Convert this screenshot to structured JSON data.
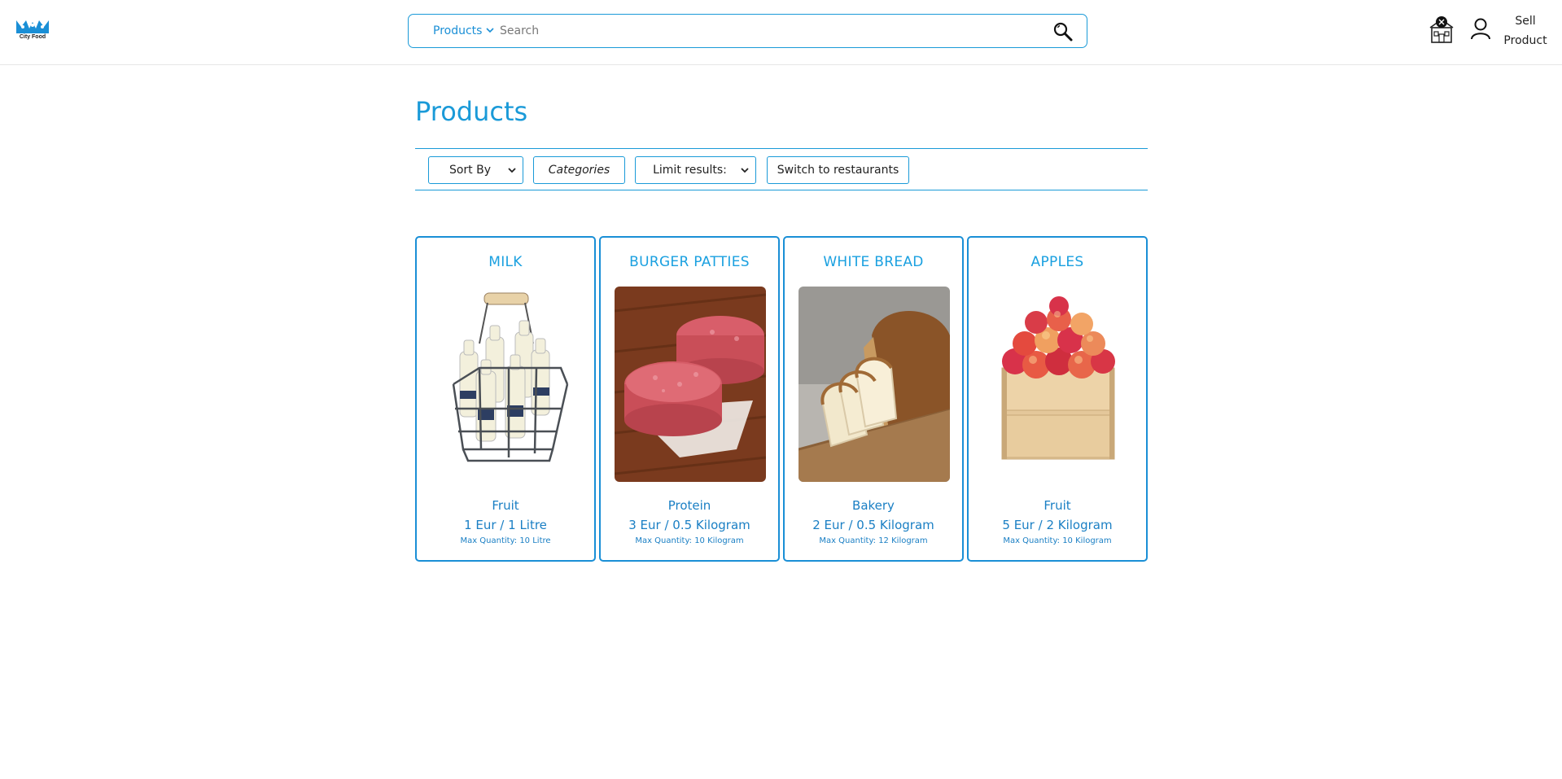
{
  "header": {
    "logo_text": "City Food",
    "search": {
      "selected_type": "Products",
      "placeholder": "Search"
    },
    "sell_label_line1": "Sell",
    "sell_label_line2": "Product",
    "icons": [
      "restaurant-icon",
      "user-icon",
      "search-icon",
      "chevron-down-icon"
    ]
  },
  "main": {
    "title": "Products",
    "toolbar": {
      "sort_label": "Sort By",
      "categories_label": "Categories",
      "limit_label": "Limit results:",
      "switch_label": "Switch to restaurants"
    },
    "products": [
      {
        "name": "MILK",
        "category": "Fruit",
        "price": "1 Eur / 1 Litre",
        "max": "Max Quantity: 10 Litre"
      },
      {
        "name": "BURGER PATTIES",
        "category": "Protein",
        "price": "3 Eur / 0.5 Kilogram",
        "max": "Max Quantity: 10 Kilogram"
      },
      {
        "name": "WHITE BREAD",
        "category": "Bakery",
        "price": "2 Eur / 0.5 Kilogram",
        "max": "Max Quantity: 12 Kilogram"
      },
      {
        "name": "APPLES",
        "category": "Fruit",
        "price": "5 Eur / 2 Kilogram",
        "max": "Max Quantity: 10 Kilogram"
      }
    ]
  },
  "colors": {
    "accent": "#1a9ad8",
    "accent_dark": "#1a7fc4"
  }
}
